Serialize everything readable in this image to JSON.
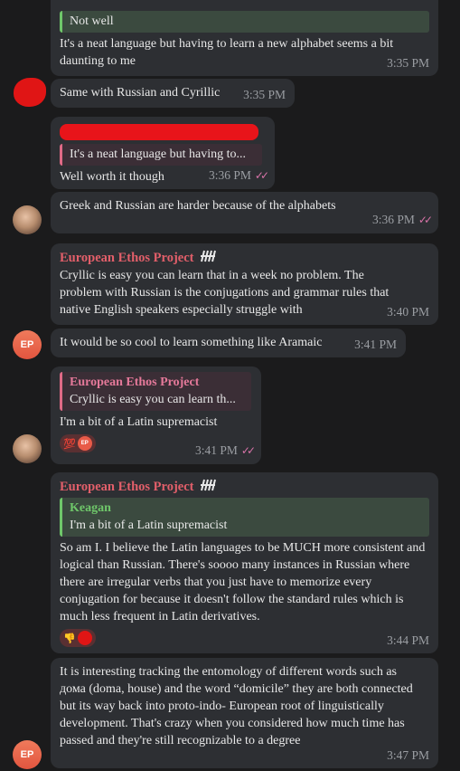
{
  "messages": {
    "m1": {
      "quote_text": "Not well",
      "text": "It's a neat language but having to learn a new alphabet seems a bit daunting to me",
      "time": "3:35 PM"
    },
    "m2": {
      "text": "Same with Russian and Cyrillic",
      "time": "3:35 PM"
    },
    "m3": {
      "quote_text": "It's a neat language but having to...",
      "text": "Well worth it though",
      "time": "3:36 PM",
      "ticks": "✓✓"
    },
    "m4": {
      "text": "Greek and Russian are harder because of the alphabets",
      "time": "3:36 PM",
      "ticks": "✓✓"
    },
    "m5": {
      "sender": "European Ethos Project",
      "text": "Cryllic is easy you can learn that in a week no problem. The problem with Russian is the conjugations and grammar rules that native English speakers especially struggle with",
      "time": "3:40 PM"
    },
    "m6": {
      "text": "It would be so cool to learn something like Aramaic",
      "time": "3:41 PM",
      "avatar": "EP"
    },
    "m7": {
      "quote_name": "European Ethos Project",
      "quote_text": "Cryllic is easy you can learn th...",
      "text": "I'm a bit of a Latin supremacist",
      "time": "3:41 PM",
      "ticks": "✓✓",
      "reaction_emoji": "💯",
      "reaction_avatar": "EP"
    },
    "m8": {
      "sender": "European Ethos Project",
      "quote_name": "Keagan",
      "quote_text": "I'm a bit of a Latin supremacist",
      "text": "So am I. I believe the Latin languages to be MUCH more consistent and logical than Russian. There's soooo many instances in Russian where there are irregular verbs that you just have to memorize every conjugation for because it doesn't follow the standard rules which is much less frequent in Latin derivatives.",
      "time": "3:44 PM",
      "reaction_emoji": "👎"
    },
    "m9": {
      "text": "It is interesting tracking the entomology of different words such as дома (doma, house) and the word “domicile” they are both connected but its way back into proto-indo- European root of linguistically development. That's crazy when you considered how much time has passed and they're still recognizable to a degree",
      "time": "3:47 PM",
      "avatar": "EP"
    }
  }
}
